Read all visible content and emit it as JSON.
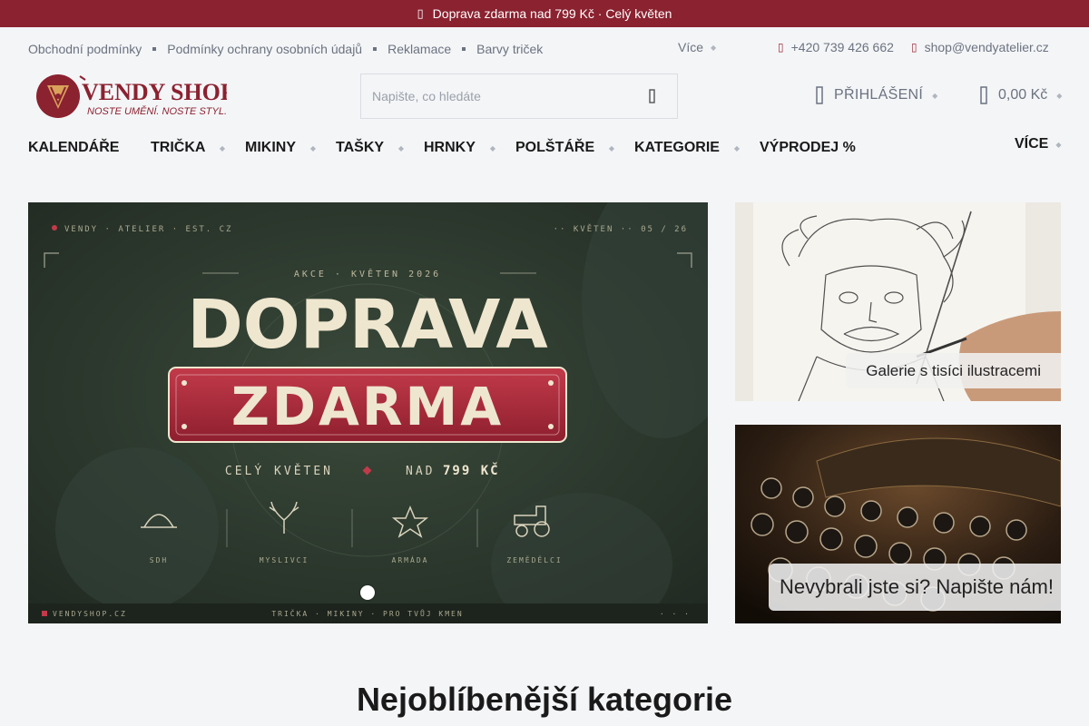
{
  "topbar": {
    "icon": "truck-icon",
    "text": "Doprava zdarma nad 799 Kč · Celý květen"
  },
  "links": [
    "Obchodní podmínky",
    "Podmínky ochrany osobních údajů",
    "Reklamace",
    "Barvy triček"
  ],
  "more_label": "Více",
  "contact": {
    "phone": "+420 739 426 662",
    "email": "shop@vendyatelier.cz"
  },
  "logo": {
    "name": "VENDY SHOP",
    "tagline": "NOSTE UMĚNÍ. NOSTE STYL."
  },
  "search": {
    "placeholder": "Napište, co hledáte",
    "value": ""
  },
  "login_label": "PŘIHLÁŠENÍ",
  "cart_total": "0,00 Kč",
  "nav": [
    {
      "label": "KALENDÁŘE",
      "has_sub": false
    },
    {
      "label": "TRIČKA",
      "has_sub": true
    },
    {
      "label": "MIKINY",
      "has_sub": true
    },
    {
      "label": "TAŠKY",
      "has_sub": true
    },
    {
      "label": "HRNKY",
      "has_sub": true
    },
    {
      "label": "POLŠTÁŘE",
      "has_sub": true
    },
    {
      "label": "KATEGORIE",
      "has_sub": true
    },
    {
      "label": "VÝPRODEJ %",
      "has_sub": false
    }
  ],
  "nav_more": "VÍCE",
  "banner": {
    "top_left": "VENDY · ATELIER · EST. CZ",
    "top_right": "·· KVĚTEN ·· 05 / 26",
    "kicker": "AKCE · KVĚTEN 2026",
    "title": "DOPRAVA",
    "plate": "ZDARMA",
    "sub_left": "CELÝ KVĚTEN",
    "sub_right_prefix": "NAD",
    "sub_right_value": "799 KČ",
    "icons": [
      {
        "icon": "helmet-icon",
        "label": "SDH"
      },
      {
        "icon": "antlers-icon",
        "label": "MYSLIVCI"
      },
      {
        "icon": "star-icon",
        "label": "ARMÁDA"
      },
      {
        "icon": "tractor-icon",
        "label": "ZEMĚDĚLCI"
      }
    ],
    "footer_left": "VENDYSHOP.CZ",
    "footer_mid": "TRIČKA · MIKINY · PRO TVŮJ KMEN",
    "footer_right": "· · ·"
  },
  "side1_caption": "Galerie s tisíci ilustracemi",
  "side2_caption": "Nevybrali jste si? Napište nám!",
  "section_heading": "Nejoblíbenější kategorie",
  "colors": {
    "brand": "#8b2230",
    "banner_bg": "#2e3a2f",
    "plate": "#a8283a",
    "cream": "#efe6cf"
  }
}
